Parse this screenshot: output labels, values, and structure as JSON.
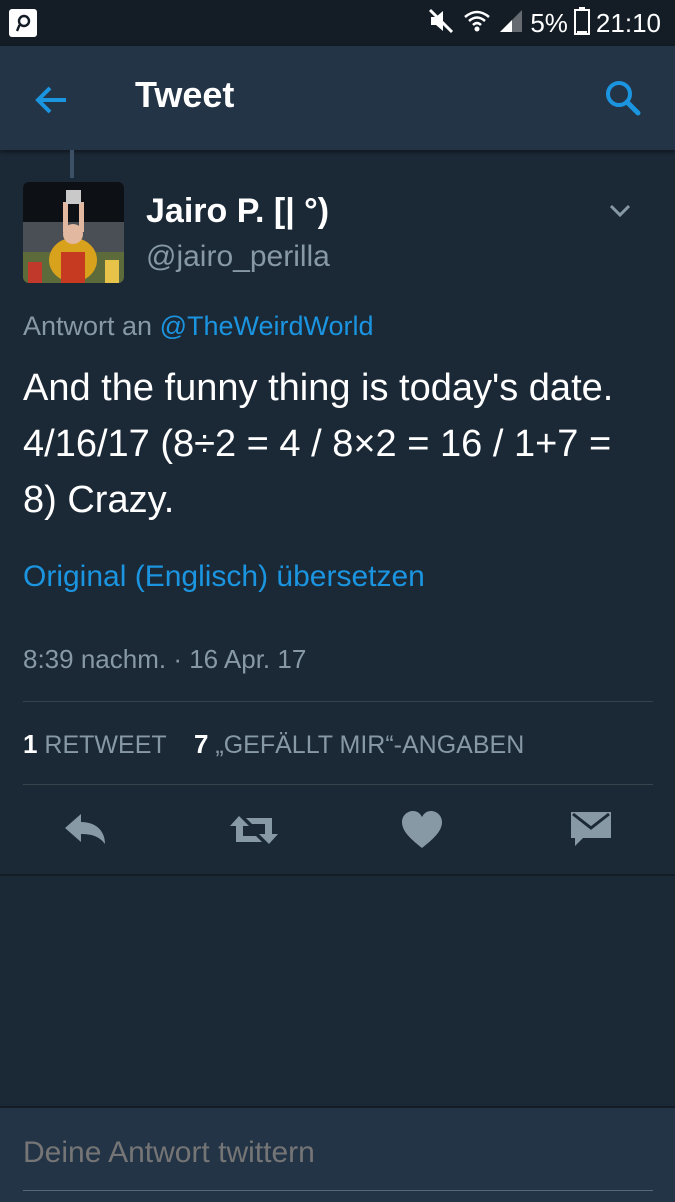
{
  "status_bar": {
    "battery": "5%",
    "time": "21:10",
    "icons": [
      "app-icon",
      "mute-icon",
      "wifi-icon",
      "signal-icon",
      "battery-icon"
    ]
  },
  "header": {
    "title": "Tweet",
    "back_icon": "back-arrow-icon",
    "search_icon": "search-icon"
  },
  "tweet": {
    "author_name": "Jairo P.  [| °)",
    "handle": "@jairo_perilla",
    "reply_prefix": "Antwort an",
    "reply_to": "@TheWeirdWorld",
    "text": "And the funny thing is today's date. 4/16/17 (8÷2 = 4 / 8×2 = 16 / 1+7 = 8) Crazy.",
    "translate_link": "Original (Englisch) übersetzen",
    "timestamp": "8:39 nachm. · 16 Apr. 17",
    "retweet_count": "1",
    "retweet_label": "RETWEET",
    "like_count": "7",
    "like_label": "„GEFÄLLT MIR“-ANGABEN"
  },
  "actions": [
    "reply-icon",
    "retweet-icon",
    "like-icon",
    "direct-message-icon"
  ],
  "compose": {
    "placeholder": "Deine Antwort twittern"
  },
  "colors": {
    "background": "#1b2836",
    "appbar": "#243447",
    "accent": "#1b95e0",
    "muted_text": "#8899a6"
  }
}
